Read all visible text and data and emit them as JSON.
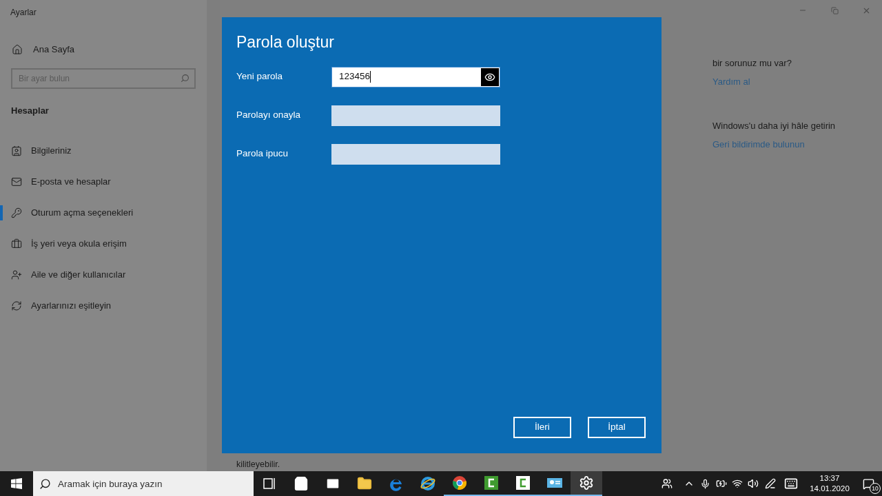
{
  "window": {
    "title": "Ayarlar"
  },
  "sidebar": {
    "home": "Ana Sayfa",
    "search": {
      "placeholder": "Bir ayar bulun"
    },
    "section": "Hesaplar",
    "items": [
      {
        "label": "Bilgileriniz",
        "kind": "person-card",
        "selected": false
      },
      {
        "label": "E-posta ve hesaplar",
        "kind": "mail",
        "selected": false
      },
      {
        "label": "Oturum açma seçenekleri",
        "kind": "key",
        "selected": true
      },
      {
        "label": "İş yeri veya okula erişim",
        "kind": "briefcase",
        "selected": false
      },
      {
        "label": "Aile ve diğer kullanıcılar",
        "kind": "person-add",
        "selected": false
      },
      {
        "label": "Ayarlarınızı eşitleyin",
        "kind": "sync",
        "selected": false
      }
    ]
  },
  "main": {
    "help_question": "bir sorunuz mu var?",
    "help_link": "Yardım al",
    "feedback_title": "Windows'u daha iyi hâle getirin",
    "feedback_link": "Geri bildirimde bulunun",
    "description": "kilitleyebilir."
  },
  "dialog": {
    "title": "Parola oluştur",
    "fields": [
      {
        "label": "Yeni parola",
        "value": "123456",
        "focused": true
      },
      {
        "label": "Parolayı onayla",
        "focused": false
      },
      {
        "label": "Parola ipucu",
        "focused": false
      }
    ],
    "buttons": [
      "İleri",
      "İptal"
    ]
  },
  "taskbar": {
    "search_placeholder": "Aramak için buraya yazın",
    "apps": [
      {
        "kind": "task-view",
        "running": false,
        "active": false
      },
      {
        "kind": "store",
        "running": false,
        "active": false
      },
      {
        "kind": "mail",
        "running": false,
        "active": false
      },
      {
        "kind": "folder",
        "running": false,
        "active": false
      },
      {
        "kind": "edge",
        "running": false,
        "active": false
      },
      {
        "kind": "ie",
        "running": false,
        "active": false
      },
      {
        "kind": "chrome",
        "running": true,
        "active": false
      },
      {
        "kind": "camtasia",
        "running": true,
        "active": false
      },
      {
        "kind": "camtasia-light",
        "running": true,
        "active": false
      },
      {
        "kind": "app",
        "running": true,
        "active": false
      },
      {
        "kind": "settings",
        "running": true,
        "active": true
      }
    ],
    "time": "13:37",
    "date": "14.01.2020",
    "notification_count": "10"
  }
}
